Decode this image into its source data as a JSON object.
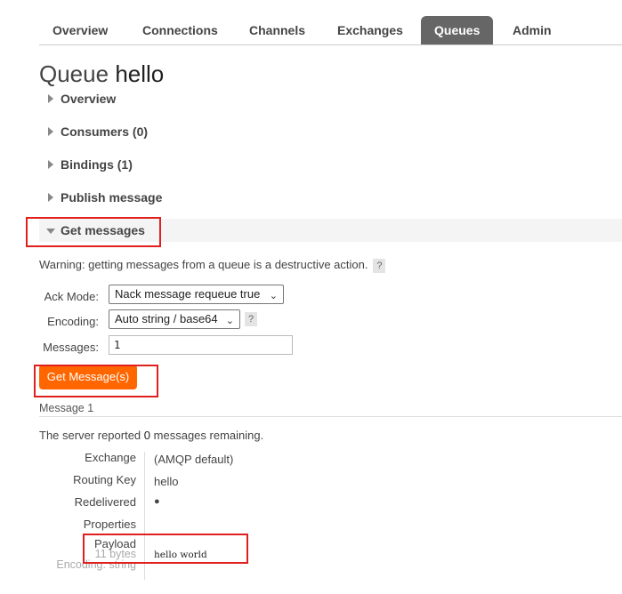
{
  "nav": {
    "tabs": [
      {
        "label": "Overview"
      },
      {
        "label": "Connections"
      },
      {
        "label": "Channels"
      },
      {
        "label": "Exchanges"
      },
      {
        "label": "Queues",
        "active": true
      },
      {
        "label": "Admin"
      }
    ]
  },
  "page": {
    "title_prefix": "Queue",
    "queue_name": "hello"
  },
  "sections": {
    "overview": "Overview",
    "consumers": "Consumers (0)",
    "bindings": "Bindings (1)",
    "publish": "Publish message",
    "get_messages": "Get messages"
  },
  "get_messages": {
    "warning": "Warning: getting messages from a queue is a destructive action.",
    "help_symbol": "?",
    "ack_mode_label": "Ack Mode:",
    "ack_mode_value": "Nack message requeue true",
    "encoding_label": "Encoding:",
    "encoding_value": "Auto string / base64",
    "messages_label": "Messages:",
    "messages_value": "1",
    "button_label": "Get Message(s)"
  },
  "message": {
    "heading": "Message 1",
    "remaining_prefix": "The server reported",
    "remaining_count": "0",
    "remaining_suffix": "messages remaining.",
    "exchange_label": "Exchange",
    "exchange_value": "(AMQP default)",
    "routing_key_label": "Routing Key",
    "routing_key_value": "hello",
    "redelivered_label": "Redelivered",
    "redelivered_value": "●",
    "properties_label": "Properties",
    "payload_label": "Payload",
    "payload_size": "11 bytes",
    "payload_encoding": "Encoding: string",
    "payload_value": "hello world"
  },
  "colors": {
    "accent_button": "#ff6600",
    "active_tab": "#666666",
    "annotation_red": "#e0201e"
  }
}
